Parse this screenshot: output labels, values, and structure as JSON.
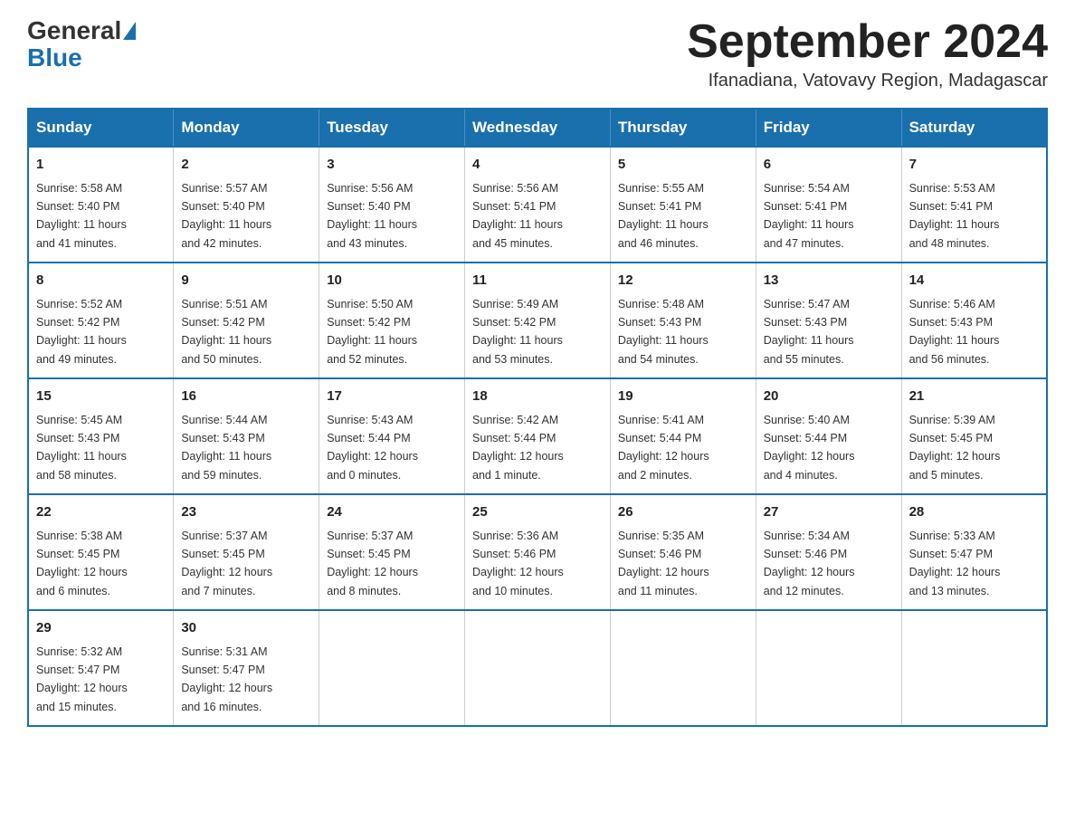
{
  "logo": {
    "general": "General",
    "blue": "Blue"
  },
  "title": "September 2024",
  "subtitle": "Ifanadiana, Vatovavy Region, Madagascar",
  "days_of_week": [
    "Sunday",
    "Monday",
    "Tuesday",
    "Wednesday",
    "Thursday",
    "Friday",
    "Saturday"
  ],
  "weeks": [
    [
      {
        "day": "1",
        "sunrise": "5:58 AM",
        "sunset": "5:40 PM",
        "daylight": "11 hours and 41 minutes."
      },
      {
        "day": "2",
        "sunrise": "5:57 AM",
        "sunset": "5:40 PM",
        "daylight": "11 hours and 42 minutes."
      },
      {
        "day": "3",
        "sunrise": "5:56 AM",
        "sunset": "5:40 PM",
        "daylight": "11 hours and 43 minutes."
      },
      {
        "day": "4",
        "sunrise": "5:56 AM",
        "sunset": "5:41 PM",
        "daylight": "11 hours and 45 minutes."
      },
      {
        "day": "5",
        "sunrise": "5:55 AM",
        "sunset": "5:41 PM",
        "daylight": "11 hours and 46 minutes."
      },
      {
        "day": "6",
        "sunrise": "5:54 AM",
        "sunset": "5:41 PM",
        "daylight": "11 hours and 47 minutes."
      },
      {
        "day": "7",
        "sunrise": "5:53 AM",
        "sunset": "5:41 PM",
        "daylight": "11 hours and 48 minutes."
      }
    ],
    [
      {
        "day": "8",
        "sunrise": "5:52 AM",
        "sunset": "5:42 PM",
        "daylight": "11 hours and 49 minutes."
      },
      {
        "day": "9",
        "sunrise": "5:51 AM",
        "sunset": "5:42 PM",
        "daylight": "11 hours and 50 minutes."
      },
      {
        "day": "10",
        "sunrise": "5:50 AM",
        "sunset": "5:42 PM",
        "daylight": "11 hours and 52 minutes."
      },
      {
        "day": "11",
        "sunrise": "5:49 AM",
        "sunset": "5:42 PM",
        "daylight": "11 hours and 53 minutes."
      },
      {
        "day": "12",
        "sunrise": "5:48 AM",
        "sunset": "5:43 PM",
        "daylight": "11 hours and 54 minutes."
      },
      {
        "day": "13",
        "sunrise": "5:47 AM",
        "sunset": "5:43 PM",
        "daylight": "11 hours and 55 minutes."
      },
      {
        "day": "14",
        "sunrise": "5:46 AM",
        "sunset": "5:43 PM",
        "daylight": "11 hours and 56 minutes."
      }
    ],
    [
      {
        "day": "15",
        "sunrise": "5:45 AM",
        "sunset": "5:43 PM",
        "daylight": "11 hours and 58 minutes."
      },
      {
        "day": "16",
        "sunrise": "5:44 AM",
        "sunset": "5:43 PM",
        "daylight": "11 hours and 59 minutes."
      },
      {
        "day": "17",
        "sunrise": "5:43 AM",
        "sunset": "5:44 PM",
        "daylight": "12 hours and 0 minutes."
      },
      {
        "day": "18",
        "sunrise": "5:42 AM",
        "sunset": "5:44 PM",
        "daylight": "12 hours and 1 minute."
      },
      {
        "day": "19",
        "sunrise": "5:41 AM",
        "sunset": "5:44 PM",
        "daylight": "12 hours and 2 minutes."
      },
      {
        "day": "20",
        "sunrise": "5:40 AM",
        "sunset": "5:44 PM",
        "daylight": "12 hours and 4 minutes."
      },
      {
        "day": "21",
        "sunrise": "5:39 AM",
        "sunset": "5:45 PM",
        "daylight": "12 hours and 5 minutes."
      }
    ],
    [
      {
        "day": "22",
        "sunrise": "5:38 AM",
        "sunset": "5:45 PM",
        "daylight": "12 hours and 6 minutes."
      },
      {
        "day": "23",
        "sunrise": "5:37 AM",
        "sunset": "5:45 PM",
        "daylight": "12 hours and 7 minutes."
      },
      {
        "day": "24",
        "sunrise": "5:37 AM",
        "sunset": "5:45 PM",
        "daylight": "12 hours and 8 minutes."
      },
      {
        "day": "25",
        "sunrise": "5:36 AM",
        "sunset": "5:46 PM",
        "daylight": "12 hours and 10 minutes."
      },
      {
        "day": "26",
        "sunrise": "5:35 AM",
        "sunset": "5:46 PM",
        "daylight": "12 hours and 11 minutes."
      },
      {
        "day": "27",
        "sunrise": "5:34 AM",
        "sunset": "5:46 PM",
        "daylight": "12 hours and 12 minutes."
      },
      {
        "day": "28",
        "sunrise": "5:33 AM",
        "sunset": "5:47 PM",
        "daylight": "12 hours and 13 minutes."
      }
    ],
    [
      {
        "day": "29",
        "sunrise": "5:32 AM",
        "sunset": "5:47 PM",
        "daylight": "12 hours and 15 minutes."
      },
      {
        "day": "30",
        "sunrise": "5:31 AM",
        "sunset": "5:47 PM",
        "daylight": "12 hours and 16 minutes."
      },
      null,
      null,
      null,
      null,
      null
    ]
  ],
  "labels": {
    "sunrise": "Sunrise:",
    "sunset": "Sunset:",
    "daylight": "Daylight:"
  }
}
